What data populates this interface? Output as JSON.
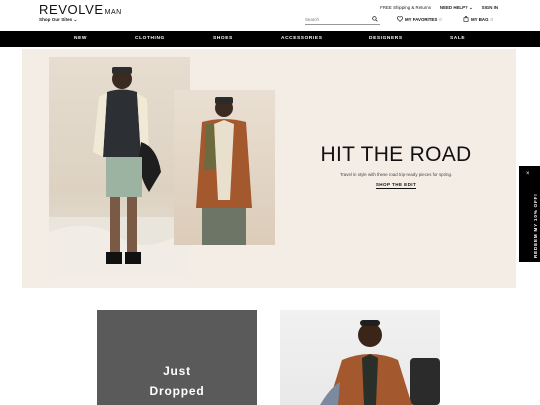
{
  "header": {
    "logo_main": "REVOLVE",
    "logo_sub": "MAN",
    "shop_our_sites": "Shop Our Sites",
    "utility_links": [
      "FREE Shipping & Returns",
      "NEED HELP?",
      "SIGN IN"
    ],
    "search_placeholder": "Search",
    "favorites_label": "MY FAVORITES",
    "favorites_count": "0",
    "bag_label": "MY BAG",
    "bag_count": "0"
  },
  "nav": {
    "items": [
      "NEW",
      "CLOTHING",
      "SHOES",
      "ACCESSORIES",
      "DESIGNERS",
      "SALE"
    ]
  },
  "hero": {
    "title": "HIT THE ROAD",
    "subtitle": "Travel in style with these road trip-ready pieces for spring.",
    "cta": "SHOP THE EDIT"
  },
  "side_tab": {
    "label": "REDEEM MY 10% OFF!",
    "close": "×"
  },
  "tiles": {
    "dark_line1": "Just",
    "dark_line2": "Dropped"
  },
  "colors": {
    "nav_bg": "#000000",
    "hero_bg": "#f4ede6",
    "tile_dark": "#5a5a5a"
  }
}
